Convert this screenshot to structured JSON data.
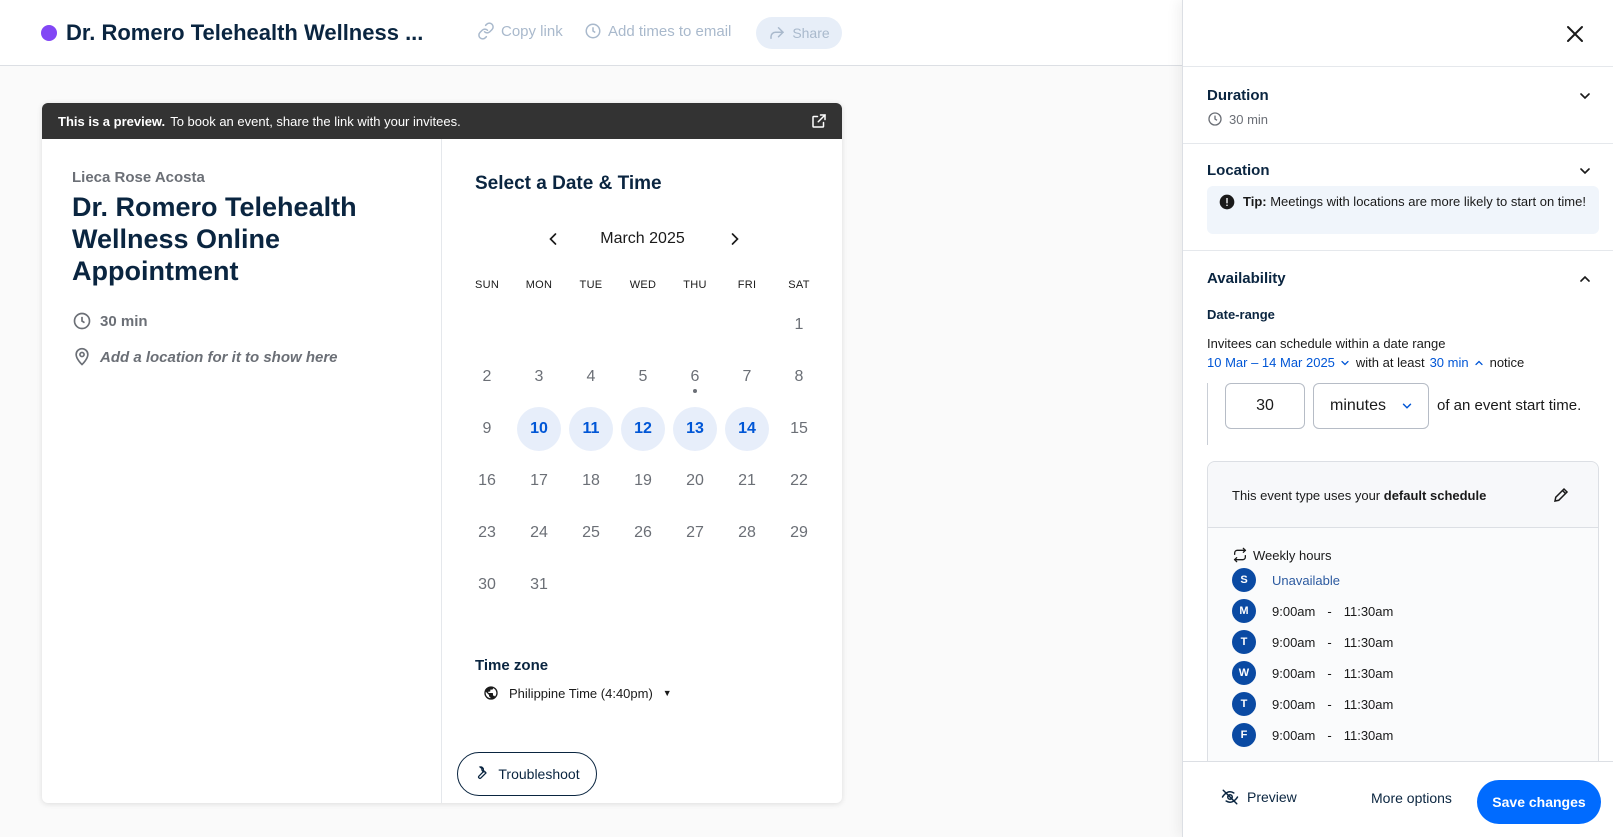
{
  "topbar": {
    "event_title": "Dr. Romero Telehealth Wellness ...",
    "copy_link": "Copy link",
    "add_times": "Add times to email",
    "share": "Share",
    "colors": {
      "event_dot": "#8247f5",
      "muted_action": "#a9b9cc"
    }
  },
  "preview": {
    "banner_bold": "This is a preview.",
    "banner_text": "To book an event, share the link with your invitees.",
    "host_name": "Lieca Rose Acosta",
    "title": "Dr. Romero Telehealth Wellness Online Appointment",
    "duration": "30 min",
    "location_hint": "Add a location for it to show here",
    "select_title": "Select a Date & Time",
    "month": "March 2025",
    "weekdays": [
      "SUN",
      "MON",
      "TUE",
      "WED",
      "THU",
      "FRI",
      "SAT"
    ],
    "calendar": {
      "first_weekday_index": 6,
      "days_in_month": 31,
      "available_days": [
        10,
        11,
        12,
        13,
        14
      ],
      "today": 6
    },
    "timezone_title": "Time zone",
    "timezone": "Philippine Time (4:40pm)",
    "troubleshoot": "Troubleshoot",
    "colors": {
      "available_bg": "#e7eefa",
      "available_text": "#0056d6"
    }
  },
  "panel": {
    "duration": {
      "title": "Duration",
      "value": "30 min"
    },
    "location": {
      "title": "Location",
      "tip_label": "Tip:",
      "tip_text": "Meetings with locations are more likely to start on time!"
    },
    "availability": {
      "title": "Availability",
      "date_range_title": "Date-range",
      "date_range_text": "Invitees can schedule within a date range",
      "range_value": "10 Mar – 14 Mar 2025",
      "with_at_least": "with at least",
      "notice_value": "30 min",
      "notice_word": "notice",
      "notice_input": "30",
      "notice_unit": "minutes",
      "notice_suffix": "of an event start time.",
      "schedule_text": "This event type uses your",
      "schedule_bold": "default schedule",
      "weekly_hours": "Weekly hours",
      "days": [
        {
          "letter": "S",
          "start": "",
          "end": "",
          "status": "Unavailable"
        },
        {
          "letter": "M",
          "start": "9:00am",
          "end": "11:30am",
          "status": ""
        },
        {
          "letter": "T",
          "start": "9:00am",
          "end": "11:30am",
          "status": ""
        },
        {
          "letter": "W",
          "start": "9:00am",
          "end": "11:30am",
          "status": ""
        },
        {
          "letter": "T",
          "start": "9:00am",
          "end": "11:30am",
          "status": ""
        },
        {
          "letter": "F",
          "start": "9:00am",
          "end": "11:30am",
          "status": ""
        }
      ],
      "time_separator": "-"
    },
    "footer": {
      "preview": "Preview",
      "more_options": "More options",
      "save": "Save changes"
    },
    "colors": {
      "primary": "#006bff",
      "day_badge": "#0a4aa3",
      "link": "#0056d6"
    }
  }
}
